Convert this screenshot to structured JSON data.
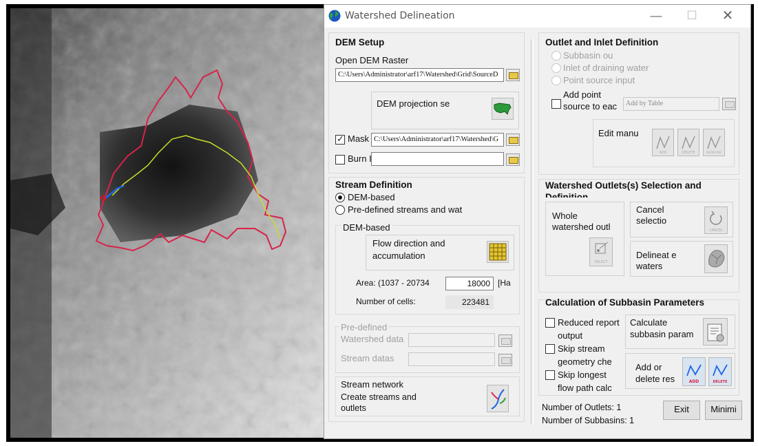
{
  "window": {
    "title": "Watershed Delineation",
    "minimize_glyph": "—",
    "maximize_glyph": "☐",
    "close_glyph": "✕"
  },
  "dem_setup": {
    "heading": "DEM Setup",
    "open_label": "Open DEM Raster",
    "dem_path": "C:\\Users\\Administrator\\arf17\\Watershed\\Grid\\SourceD",
    "projection_label": "DEM projection se",
    "mask_label": "Mask",
    "mask_checked": true,
    "mask_path": "C:\\Users\\Administrator\\arf17\\Watershed\\G",
    "burn_label": "Burn I",
    "burn_checked": false,
    "burn_path": ""
  },
  "stream_definition": {
    "heading": "Stream Definition",
    "option_dem": "DEM-based",
    "option_predefined": "Pre-defined streams and wat",
    "selected": "DEM-based",
    "dem_group_label": "DEM-based",
    "flow_label": "Flow direction and accumulation",
    "area_label": "Area:  (1037  - 20734",
    "area_value": "18000",
    "area_unit": "[Ha",
    "cells_label": "Number of cells:",
    "cells_value": "223481",
    "predefined_group_label": "Pre-defined",
    "watershed_data_label": "Watershed data",
    "stream_data_label": "Stream datas",
    "network_label": "Stream network",
    "create_label": "Create streams and outlets"
  },
  "outlet_inlet": {
    "heading": "Outlet and Inlet Definition",
    "subbasin_outlet": "Subbasin ou",
    "inlet_draining": "Inlet of draining water",
    "point_source": "Point source input",
    "add_point_label": "Add point source to eac",
    "add_by_table": "Add by Table",
    "edit_manual": "Edit manu",
    "icon_add": "ADD",
    "icon_delete": "DELETE",
    "icon_redefine": "REDEFINE"
  },
  "outlet_selection": {
    "heading": "Watershed Outlets(s) Selection and Definition",
    "whole_label": "Whole watershed outl",
    "select_icon": "SELECT",
    "cancel_label": "Cancel selectio",
    "cancel_icon": "CANCEL",
    "delineate_label": "Delineat e waters"
  },
  "subbasin_params": {
    "heading": "Calculation of Subbasin Parameters",
    "reduced_label": "Reduced report output",
    "skip_stream_label": "Skip stream geometry che",
    "skip_longest_label": "Skip longest flow path calc",
    "calculate_label": "Calculate subbasin param",
    "add_delete_label": "Add or delete res",
    "icon_add": "ADD",
    "icon_delete": "DELETE"
  },
  "footer": {
    "outlets": "Number of Outlets: 1",
    "subbasins": "Number of Subbasins: 1",
    "exit_label": "Exit",
    "minimize_label": "Minimi"
  },
  "colors": {
    "boundary": "#d8234a",
    "main_stream": "#c9dd2a",
    "outlet_stream": "#1e64e6",
    "outlet_point": "#e0102a"
  },
  "icons": {
    "app": "globe-icon",
    "projection": "us-map-icon",
    "flow": "grid-icon",
    "stream": "stream-network-icon"
  }
}
